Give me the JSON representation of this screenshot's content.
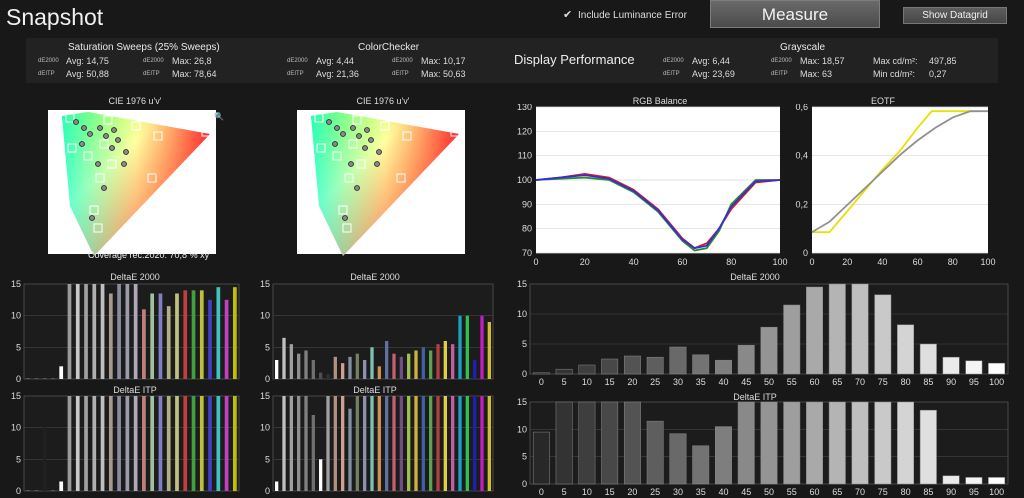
{
  "header": {
    "title": "Snapshot",
    "luminance_label": "Include Luminance Error",
    "measure_label": "Measure",
    "datagrid_label": "Show Datagrid"
  },
  "summary": {
    "saturation": {
      "title": "Saturation Sweeps (25% Sweeps)",
      "de2000_label": "dE2000",
      "deitp_label": "dEITP",
      "de_avg": "Avg: 14,75",
      "de_max": "Max: 26,8",
      "itp_avg": "Avg: 50,88",
      "itp_max": "Max: 78,64"
    },
    "colorchecker": {
      "title": "ColorChecker",
      "de2000_label": "dE2000",
      "deitp_label": "dEITP",
      "de_avg": "Avg: 4,44",
      "de_max": "Max: 10,17",
      "itp_avg": "Avg: 21,36",
      "itp_max": "Max: 50,63"
    },
    "display_performance": "Display Performance",
    "grayscale": {
      "title": "Grayscale",
      "de2000_label": "dE2000",
      "deitp_label": "dEITP",
      "de_avg": "Avg: 6,44",
      "de_max": "Max: 18,57",
      "itp_avg": "Avg: 23,69",
      "itp_max": "Max: 63",
      "max_lum_label": "Max cd/m²:",
      "max_lum": "497,85",
      "min_lum_label": "Min cd/m²:",
      "min_lum": "0,27"
    }
  },
  "colors": {
    "red": "#e01818",
    "green": "#2f8a2f",
    "blue": "#3030d8",
    "yellow": "#e8e000",
    "gray": "#909090"
  },
  "chart_data": [
    {
      "id": "cie1",
      "type": "scatter",
      "title": "CIE 1976 u'v'",
      "annotation": "Coverage rec.2020: 70,8 % xy",
      "icon": "magnifier-icon"
    },
    {
      "id": "cie2",
      "type": "scatter",
      "title": "CIE 1976 u'v'",
      "icon": ""
    },
    {
      "id": "rgb",
      "type": "line",
      "title": "RGB Balance",
      "x": [
        0,
        10,
        20,
        30,
        40,
        50,
        60,
        65,
        70,
        75,
        80,
        90,
        100
      ],
      "xlim": [
        0,
        100
      ],
      "ylim": [
        70,
        130
      ],
      "xticks": [
        "0",
        "20",
        "40",
        "60",
        "80",
        "100"
      ],
      "yticks": [
        "70",
        "80",
        "90",
        "100",
        "110",
        "120",
        "130"
      ],
      "series": [
        {
          "color": "#e01818",
          "values": [
            100,
            101,
            102.5,
            101,
            96,
            88,
            76,
            72,
            74,
            80,
            88,
            99,
            100
          ]
        },
        {
          "color": "#2f8a2f",
          "values": [
            100,
            100.5,
            101,
            100,
            95,
            87,
            75,
            71,
            72,
            79,
            90,
            100,
            100
          ]
        },
        {
          "color": "#3030d8",
          "values": [
            100,
            101,
            102,
            100.5,
            95.5,
            87.5,
            75.5,
            72,
            73,
            80,
            89,
            99.5,
            100
          ]
        }
      ]
    },
    {
      "id": "eotf",
      "type": "line",
      "title": "EOTF",
      "xlim": [
        0,
        100
      ],
      "ylim": [
        0,
        0.7
      ],
      "xticks": [
        "0",
        "20",
        "40",
        "60",
        "80",
        "100"
      ],
      "yticks": [
        "0",
        "0,2",
        "0,4",
        "0,6"
      ],
      "series": [
        {
          "color": "#e8e000",
          "x": [
            0,
            5,
            10,
            20,
            30,
            40,
            50,
            60,
            68,
            75,
            85,
            95
          ],
          "values": [
            0.1,
            0.1,
            0.1,
            0.2,
            0.3,
            0.4,
            0.49,
            0.6,
            0.68,
            0.68,
            0.68,
            0.68
          ]
        },
        {
          "color": "#909090",
          "x": [
            0,
            10,
            20,
            30,
            40,
            50,
            60,
            70,
            80,
            90,
            100
          ],
          "values": [
            0.1,
            0.15,
            0.23,
            0.31,
            0.39,
            0.47,
            0.54,
            0.6,
            0.65,
            0.68,
            0.68
          ]
        }
      ]
    },
    {
      "id": "sat_de",
      "type": "bar",
      "title": "DeltaE 2000",
      "ylim": [
        0,
        15
      ],
      "yticks": [
        "0",
        "5",
        "10",
        "15"
      ],
      "bars": [
        [
          0.1,
          "#777"
        ],
        [
          0.1,
          "#777"
        ],
        [
          0.1,
          "#777"
        ],
        [
          0.1,
          "#777"
        ],
        [
          2,
          "#ffffff"
        ],
        [
          15,
          "#9a9a9a"
        ],
        [
          15,
          "#c8c8c8"
        ],
        [
          15,
          "#a0a0a0"
        ],
        [
          15,
          "#b0b0b0"
        ],
        [
          15,
          "#c0c0c0"
        ],
        [
          13.5,
          "#a89890"
        ],
        [
          15,
          "#8a8aa0"
        ],
        [
          15,
          "#9a9aaa"
        ],
        [
          15,
          "#b0a8b8"
        ],
        [
          11,
          "#c08080"
        ],
        [
          13.5,
          "#a0c0a0"
        ],
        [
          13.5,
          "#8080c0"
        ],
        [
          11.5,
          "#b0b080"
        ],
        [
          13.5,
          "#c0c080"
        ],
        [
          14,
          "#c04040"
        ],
        [
          14,
          "#40a040"
        ],
        [
          14,
          "#c0c040"
        ],
        [
          12.5,
          "#4040c0"
        ],
        [
          14.5,
          "#40c0c0"
        ],
        [
          12.5,
          "#c040c0"
        ],
        [
          14.5,
          "#c0c000"
        ]
      ]
    },
    {
      "id": "cc_de",
      "type": "bar",
      "title": "DeltaE 2000",
      "ylim": [
        0,
        15
      ],
      "yticks": [
        "0",
        "5",
        "10",
        "15"
      ],
      "bars": [
        [
          3,
          "#ffffff"
        ],
        [
          6.5,
          "#c0c0c0"
        ],
        [
          5.5,
          "#a0a0a0"
        ],
        [
          4,
          "#909090"
        ],
        [
          4.5,
          "#808080"
        ],
        [
          3,
          "#707070"
        ],
        [
          1,
          "#505050"
        ],
        [
          0.8,
          "#303030"
        ],
        [
          3.5,
          "#b09080"
        ],
        [
          2.5,
          "#d0a090"
        ],
        [
          3.5,
          "#8090a0"
        ],
        [
          4,
          "#708060"
        ],
        [
          3,
          "#9090b0"
        ],
        [
          5,
          "#80c0b0"
        ],
        [
          2,
          "#d09050"
        ],
        [
          6,
          "#6070a0"
        ],
        [
          4,
          "#c06070"
        ],
        [
          3.5,
          "#705080"
        ],
        [
          4,
          "#a0c050"
        ],
        [
          4.5,
          "#d0b040"
        ],
        [
          5,
          "#4060a0"
        ],
        [
          4.5,
          "#60a050"
        ],
        [
          5.5,
          "#b04040"
        ],
        [
          6,
          "#e0d040"
        ],
        [
          5.5,
          "#c060a0"
        ],
        [
          10,
          "#20a0c0"
        ],
        [
          10,
          "#30c050"
        ],
        [
          3,
          "#2020b0"
        ],
        [
          10,
          "#c020c0"
        ],
        [
          9,
          "#d0c030"
        ]
      ]
    },
    {
      "id": "gray_de",
      "type": "bar",
      "title": "DeltaE 2000",
      "ylim": [
        0,
        15
      ],
      "yticks": [
        "0",
        "5",
        "10",
        "15"
      ],
      "categories": [
        "0",
        "5",
        "10",
        "15",
        "20",
        "25",
        "30",
        "35",
        "40",
        "45",
        "50",
        "55",
        "60",
        "65",
        "70",
        "75",
        "80",
        "85",
        "90",
        "95",
        "100"
      ],
      "values": [
        0.2,
        0.8,
        1.5,
        2.5,
        3,
        2.8,
        4.5,
        3.2,
        2.3,
        4.8,
        7.8,
        11.5,
        14.5,
        15,
        15,
        13.2,
        8.2,
        5,
        2.8,
        2.2,
        1.8
      ]
    },
    {
      "id": "sat_itp",
      "type": "bar",
      "title": "DeltaE ITP",
      "ylim": [
        0,
        15
      ],
      "yticks": [
        "0",
        "5",
        "10",
        "15"
      ],
      "bars": [
        [
          0.1,
          "#777"
        ],
        [
          0.1,
          "#777"
        ],
        [
          10,
          "#202020"
        ],
        [
          0.1,
          "#777"
        ],
        [
          1.5,
          "#ffffff"
        ],
        [
          15,
          "#9a9a9a"
        ],
        [
          15,
          "#c8c8c8"
        ],
        [
          15,
          "#a0a0a0"
        ],
        [
          15,
          "#b0b0b0"
        ],
        [
          15,
          "#c0c0c0"
        ],
        [
          15,
          "#a89890"
        ],
        [
          15,
          "#8a8aa0"
        ],
        [
          15,
          "#9a9aaa"
        ],
        [
          15,
          "#b0a8b8"
        ],
        [
          15,
          "#c08080"
        ],
        [
          15,
          "#a0c0a0"
        ],
        [
          15,
          "#8080c0"
        ],
        [
          15,
          "#b0b080"
        ],
        [
          15,
          "#c0c080"
        ],
        [
          15,
          "#c04040"
        ],
        [
          15,
          "#40a040"
        ],
        [
          15,
          "#c0c040"
        ],
        [
          15,
          "#4040c0"
        ],
        [
          15,
          "#40c0c0"
        ],
        [
          15,
          "#c040c0"
        ],
        [
          15,
          "#c0c000"
        ]
      ]
    },
    {
      "id": "cc_itp",
      "type": "bar",
      "title": "DeltaE ITP",
      "ylim": [
        0,
        15
      ],
      "yticks": [
        "0",
        "5",
        "10",
        "15"
      ],
      "bars": [
        [
          1.5,
          "#ffffff"
        ],
        [
          15,
          "#c0c0c0"
        ],
        [
          15,
          "#a0a0a0"
        ],
        [
          15,
          "#909090"
        ],
        [
          15,
          "#808080"
        ],
        [
          12,
          "#707070"
        ],
        [
          5,
          "#ffffff"
        ],
        [
          15,
          "#a0a0a0"
        ],
        [
          15,
          "#b09080"
        ],
        [
          15,
          "#d0a090"
        ],
        [
          13,
          "#8090a0"
        ],
        [
          15,
          "#708060"
        ],
        [
          15,
          "#9090b0"
        ],
        [
          15,
          "#80c0b0"
        ],
        [
          15,
          "#d09050"
        ],
        [
          15,
          "#6070a0"
        ],
        [
          15,
          "#c06070"
        ],
        [
          15,
          "#705080"
        ],
        [
          15,
          "#a0c050"
        ],
        [
          15,
          "#d0b040"
        ],
        [
          15,
          "#4060a0"
        ],
        [
          15,
          "#60a050"
        ],
        [
          15,
          "#b04040"
        ],
        [
          15,
          "#e0d040"
        ],
        [
          15,
          "#c060a0"
        ],
        [
          15,
          "#20a0c0"
        ],
        [
          15,
          "#30c050"
        ],
        [
          15,
          "#2020b0"
        ],
        [
          15,
          "#c020c0"
        ],
        [
          15,
          "#d0c030"
        ]
      ]
    },
    {
      "id": "gray_itp",
      "type": "bar",
      "title": "DeltaE ITP",
      "ylim": [
        0,
        15
      ],
      "yticks": [
        "0",
        "5",
        "10",
        "15"
      ],
      "categories": [
        "0",
        "5",
        "10",
        "15",
        "20",
        "25",
        "30",
        "35",
        "40",
        "45",
        "50",
        "55",
        "60",
        "65",
        "70",
        "75",
        "80",
        "85",
        "90",
        "95",
        "100"
      ],
      "values": [
        9.5,
        15,
        15,
        15,
        15,
        11.5,
        9.2,
        7,
        10.5,
        15,
        15,
        15,
        15,
        15,
        15,
        15,
        15,
        13.5,
        1.5,
        1.2,
        1.2
      ]
    }
  ]
}
